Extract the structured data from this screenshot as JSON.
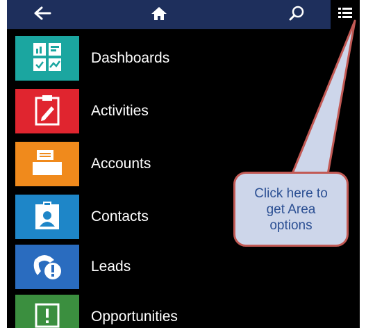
{
  "topbar": {
    "back_icon": "arrow-left-icon",
    "home_icon": "home-icon",
    "search_icon": "search-icon",
    "menu_icon": "list-icon"
  },
  "nav": {
    "items": [
      {
        "label": "Dashboards",
        "icon": "dashboard-icon",
        "color": "#1ba6a0"
      },
      {
        "label": "Activities",
        "icon": "clipboard-icon",
        "color": "#e0252f"
      },
      {
        "label": "Accounts",
        "icon": "accounts-icon",
        "color": "#f08a1c"
      },
      {
        "label": "Contacts",
        "icon": "contact-icon",
        "color": "#1e86c8"
      },
      {
        "label": "Leads",
        "icon": "phone-alert-icon",
        "color": "#2a6cbf"
      },
      {
        "label": "Opportunities",
        "icon": "opportunity-icon",
        "color": "#3b8f3f"
      }
    ]
  },
  "callout": {
    "text": "Click here to\nget  Area\noptions",
    "fill": "#cdd6ea",
    "border": "#c25a55",
    "text_color": "#2b4f93"
  }
}
